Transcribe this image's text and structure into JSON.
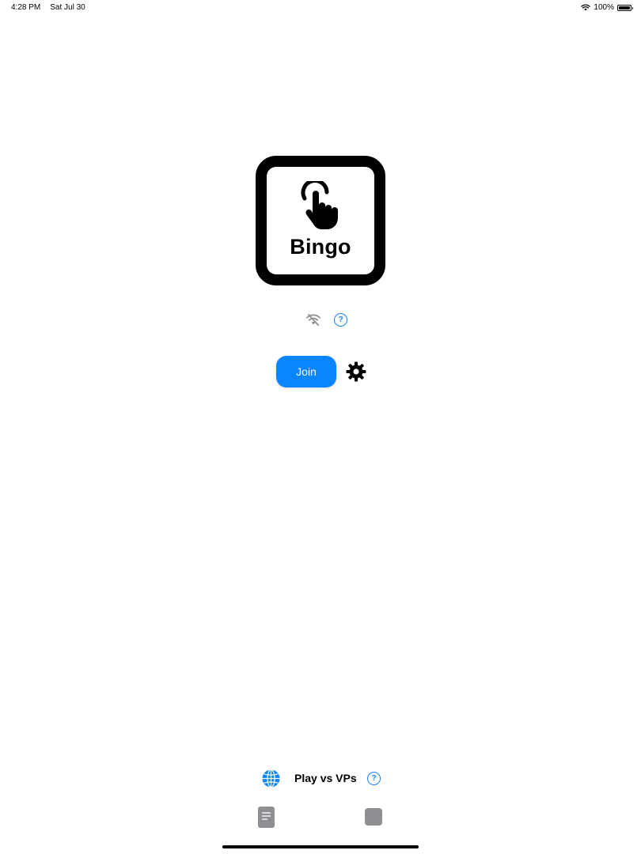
{
  "status_bar": {
    "time": "4:28 PM",
    "date": "Sat Jul 30",
    "battery": "100%",
    "battery_level": 1.0,
    "wifi_icon": "wifi-icon"
  },
  "logo": {
    "text": "Bingo",
    "icon": "hand-tap-icon"
  },
  "connection": {
    "icon": "wifi-off-icon",
    "help": "?"
  },
  "join": {
    "label": "Join",
    "settings_icon": "gear-icon"
  },
  "bottom": {
    "globe_icon": "globe-icon",
    "label": "Play vs VPs",
    "help": "?",
    "tab_icons": [
      "document-icon",
      "square-icon"
    ]
  },
  "colors": {
    "accent": "#0a84ff",
    "help_blue": "#1a82f7",
    "gray_icon": "#8e8e93"
  }
}
